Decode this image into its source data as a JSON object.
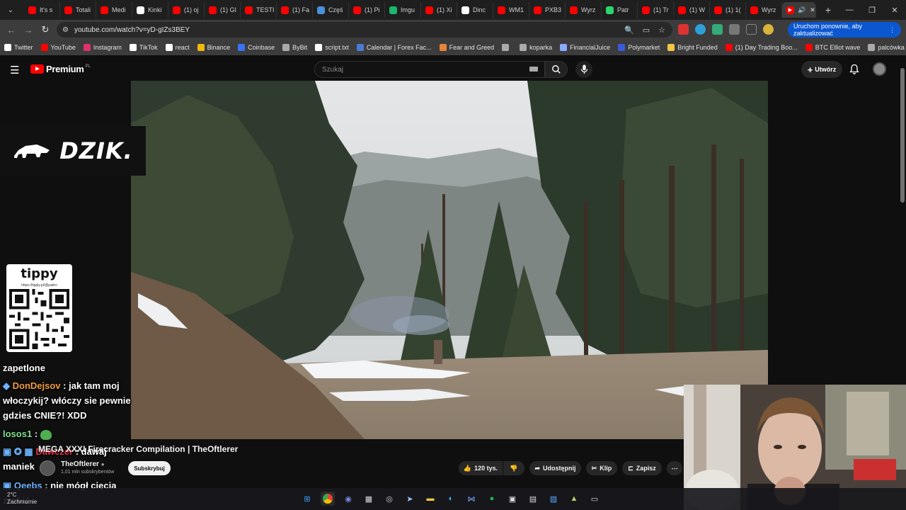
{
  "browser": {
    "tabs": [
      {
        "label": "It's s",
        "color": "#ff0000"
      },
      {
        "label": "Totali",
        "color": "#ff0000"
      },
      {
        "label": "Medi",
        "color": "#ff0000"
      },
      {
        "label": "Kinki",
        "color": "#ffffff"
      },
      {
        "label": "(1) oj",
        "color": "#ff0000"
      },
      {
        "label": "(1) GI",
        "color": "#ff0000"
      },
      {
        "label": "TESTI",
        "color": "#ff0000"
      },
      {
        "label": "(1) Fa",
        "color": "#ff0000"
      },
      {
        "label": "Częś",
        "color": "#4a90d9"
      },
      {
        "label": "(1) Pi",
        "color": "#ff0000"
      },
      {
        "label": "Imgu",
        "color": "#1bb76e"
      },
      {
        "label": "(1) Xi",
        "color": "#ff0000"
      },
      {
        "label": "Dinc",
        "color": "#ffffff"
      },
      {
        "label": "WM1",
        "color": "#ff0000"
      },
      {
        "label": "PXB3",
        "color": "#ff0000"
      },
      {
        "label": "Wyrz",
        "color": "#ff0000"
      },
      {
        "label": "Patr",
        "color": "#2bd66b"
      },
      {
        "label": "(1) Tr",
        "color": "#ff0000"
      },
      {
        "label": "(1) W",
        "color": "#ff0000"
      },
      {
        "label": "(1) 1(",
        "color": "#ff0000"
      },
      {
        "label": "Wyrz",
        "color": "#ff0000"
      }
    ],
    "active_tab": {
      "color": "#ff0000"
    },
    "url": "youtube.com/watch?v=yD-gIZs3BEY",
    "update_button": "Uruchom ponownie, aby zaktualizować",
    "bookmarks": [
      {
        "label": "Twitter",
        "color": "#ffffff"
      },
      {
        "label": "YouTube",
        "color": "#ff0000"
      },
      {
        "label": "Instagram",
        "color": "#e1306c"
      },
      {
        "label": "TikTok",
        "color": "#ffffff"
      },
      {
        "label": "react",
        "color": "#ffffff"
      },
      {
        "label": "Binance",
        "color": "#f0b90b"
      },
      {
        "label": "Coinbase",
        "color": "#3773f5"
      },
      {
        "label": "ByBit",
        "color": "#aaaaaa"
      },
      {
        "label": "script.txt",
        "color": "#ffffff"
      },
      {
        "label": "Calendar | Forex Fac...",
        "color": "#4a7bd4"
      },
      {
        "label": "Fear and Greed",
        "color": "#e8833a"
      },
      {
        "label": "",
        "color": "#aaaaaa"
      },
      {
        "label": "koparka",
        "color": "#aaaaaa"
      },
      {
        "label": "FinancialJuice",
        "color": "#88aaff"
      },
      {
        "label": "Polymarket",
        "color": "#3a5bd9"
      },
      {
        "label": "Bright Funded",
        "color": "#f2c744"
      },
      {
        "label": "(1) Day Trading Boo...",
        "color": "#ff0000"
      },
      {
        "label": "BTC Elliot wave",
        "color": "#ff0000"
      },
      {
        "label": "palcówka",
        "color": "#aaaaaa"
      }
    ]
  },
  "youtube": {
    "logo": "Premium",
    "logo_country": "PL",
    "search_placeholder": "Szukaj",
    "create_label": "Utwórz",
    "video_title": "MEGA XXX! Firecracker Compilation | TheOftlerer",
    "channel_name": "TheOftlerer",
    "channel_subs": "1,01 mln subskrybentów",
    "subscribe_label": "Subskrybuj",
    "like_count": "120 tys.",
    "share_label": "Udostępnij",
    "clip_label": "Klip",
    "save_label": "Zapisz"
  },
  "overlay": {
    "banner": "DZIK.",
    "tippy_title": "tippy",
    "tippy_link": "https://tipply.pl/@patiro",
    "chat": [
      {
        "user": "",
        "text": "zapetlone"
      },
      {
        "user": "DonDejsov",
        "text": ": jak tam moj włoczykij? włóczy sie pewnie gdzies CNIE?! XDD"
      },
      {
        "user": "losos1",
        "text": ":"
      },
      {
        "user": "Dawczer",
        "text": ": dawaj maniek"
      },
      {
        "user": "Qeebs",
        "text": ": nie mógł cięcia zrobić"
      }
    ]
  },
  "taskbar": {
    "temperature": "2°C",
    "weather": "Zachmurnie"
  }
}
